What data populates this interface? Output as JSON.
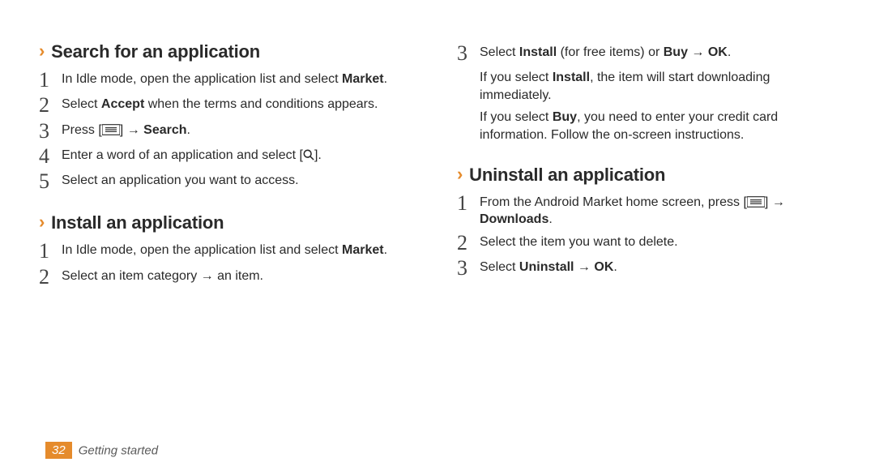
{
  "sections": {
    "search": {
      "heading": "Search for an application",
      "step1_pre": "In Idle mode, open the application list and select ",
      "step1_bold": "Market",
      "step1_post": ".",
      "step2_pre": "Select ",
      "step2_bold": "Accept",
      "step2_post": " when the terms and conditions appears.",
      "step3_pre": "Press [",
      "step3_mid": "] → ",
      "step3_bold": "Search",
      "step3_post": ".",
      "step4_pre": "Enter a word of an application and select [",
      "step4_post": "].",
      "step5": "Select an application you want to access."
    },
    "install": {
      "heading": "Install an application",
      "step1_pre": "In Idle mode, open the application list and select ",
      "step1_bold": "Market",
      "step1_post": ".",
      "step2": "Select an item category → an item.",
      "step3_a": "Select ",
      "step3_b": "Install",
      "step3_c": " (for free items) or ",
      "step3_d": "Buy",
      "step3_e": " → ",
      "step3_f": "OK",
      "step3_g": ".",
      "note1_a": "If you select ",
      "note1_b": "Install",
      "note1_c": ", the item will start downloading immediately.",
      "note2_a": "If you select ",
      "note2_b": "Buy",
      "note2_c": ", you need to enter your credit card information. Follow the on-screen instructions."
    },
    "uninstall": {
      "heading": "Uninstall an application",
      "step1_a": "From the Android Market home screen, press [",
      "step1_b": "] → ",
      "step1_c": "Downloads",
      "step1_d": ".",
      "step2": "Select the item you want to delete.",
      "step3_a": "Select ",
      "step3_b": "Uninstall",
      "step3_c": " → ",
      "step3_d": "OK",
      "step3_e": "."
    }
  },
  "nums": {
    "n1": "1",
    "n2": "2",
    "n3": "3",
    "n4": "4",
    "n5": "5"
  },
  "footer": {
    "page": "32",
    "section": "Getting started"
  }
}
